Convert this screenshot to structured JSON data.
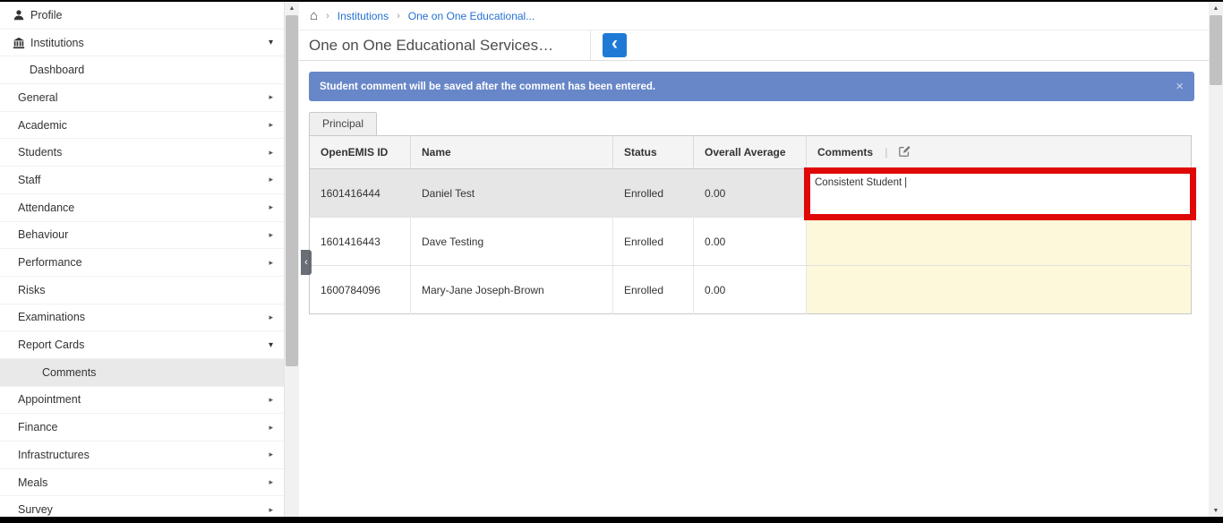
{
  "glyphs": {
    "home": "⌂",
    "breadcrumb_separator": "›",
    "caret_down": "▾",
    "arrow_right": "▸",
    "back": "‹",
    "collapse": "‹",
    "close": "×",
    "pipe": "|",
    "scroll_up": "▲",
    "scroll_down": "▼",
    "cursor": "|"
  },
  "sidebar": {
    "items": [
      {
        "label": "Profile"
      },
      {
        "label": "Institutions"
      },
      {
        "label": "Dashboard"
      },
      {
        "label": "General"
      },
      {
        "label": "Academic"
      },
      {
        "label": "Students"
      },
      {
        "label": "Staff"
      },
      {
        "label": "Attendance"
      },
      {
        "label": "Behaviour"
      },
      {
        "label": "Performance"
      },
      {
        "label": "Risks"
      },
      {
        "label": "Examinations"
      },
      {
        "label": "Report Cards"
      },
      {
        "label": "Comments"
      },
      {
        "label": "Appointment"
      },
      {
        "label": "Finance"
      },
      {
        "label": "Infrastructures"
      },
      {
        "label": "Meals"
      },
      {
        "label": "Survey"
      }
    ]
  },
  "breadcrumb": {
    "links": [
      "Institutions",
      "One on One Educational..."
    ]
  },
  "header": {
    "title": "One on One Educational Services…"
  },
  "alert": {
    "message": "Student comment will be saved after the comment has been entered."
  },
  "tabs": {
    "principal": "Principal"
  },
  "table": {
    "headers": {
      "id": "OpenEMIS ID",
      "name": "Name",
      "status": "Status",
      "average": "Overall Average",
      "comments": "Comments"
    },
    "rows": [
      {
        "id": "1601416444",
        "name": "Daniel Test",
        "status": "Enrolled",
        "average": "0.00",
        "comment": "Consistent Student"
      },
      {
        "id": "1601416443",
        "name": "Dave Testing",
        "status": "Enrolled",
        "average": "0.00",
        "comment": ""
      },
      {
        "id": "1600784096",
        "name": "Mary-Jane Joseph-Brown",
        "status": "Enrolled",
        "average": "0.00",
        "comment": ""
      }
    ]
  },
  "colors": {
    "link_blue": "#2571d0",
    "back_button_blue": "#1f7ad6",
    "alert_blue": "#6887c8",
    "annotation_red": "#e00707",
    "comment_yellow": "#fdf8d9",
    "selected_row_gray": "#e6e6e6"
  }
}
